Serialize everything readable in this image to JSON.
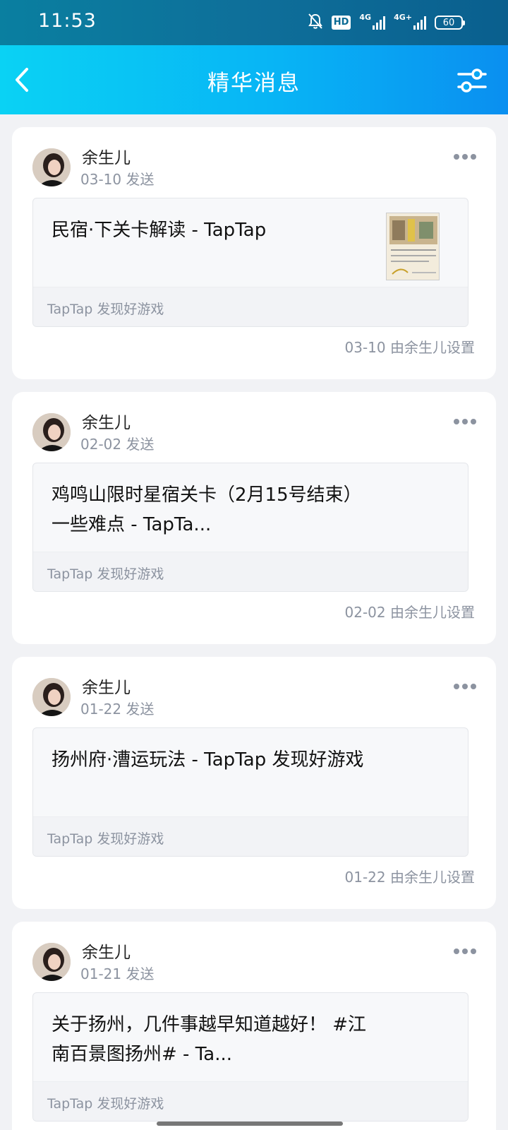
{
  "status_bar": {
    "time": "11:53",
    "hd": "HD",
    "net_1": "4G",
    "net_2": "4G+",
    "battery": "60",
    "icons": [
      "bell-muted-icon",
      "hd-icon",
      "signal-icon",
      "signal-icon",
      "battery-icon"
    ]
  },
  "header": {
    "title": "精华消息",
    "back_icon": "chevron-left-icon",
    "filter_icon": "sliders-icon"
  },
  "posts": [
    {
      "author": "余生儿",
      "sent": "03-10 发送",
      "link_title": "民宿·下关卡解读 - TapTap",
      "link_source": "TapTap 发现好游戏",
      "has_thumbnail": true,
      "pinned_note": "03-10 由余生儿设置"
    },
    {
      "author": "余生儿",
      "sent": "02-02 发送",
      "link_title": "鸡鸣山限时星宿关卡（2月15号结束）一些难点 - TapTa...",
      "link_source": "TapTap 发现好游戏",
      "has_thumbnail": false,
      "pinned_note": "02-02 由余生儿设置"
    },
    {
      "author": "余生儿",
      "sent": "01-22 发送",
      "link_title": "扬州府·漕运玩法 - TapTap 发现好游戏",
      "link_source": "TapTap 发现好游戏",
      "has_thumbnail": false,
      "pinned_note": "01-22 由余生儿设置"
    },
    {
      "author": "余生儿",
      "sent": "01-21 发送",
      "link_title": "关于扬州，几件事越早知道越好！ #江南百景图扬州# - Ta...",
      "link_source": "TapTap 发现好游戏",
      "has_thumbnail": false,
      "pinned_note": ""
    }
  ]
}
